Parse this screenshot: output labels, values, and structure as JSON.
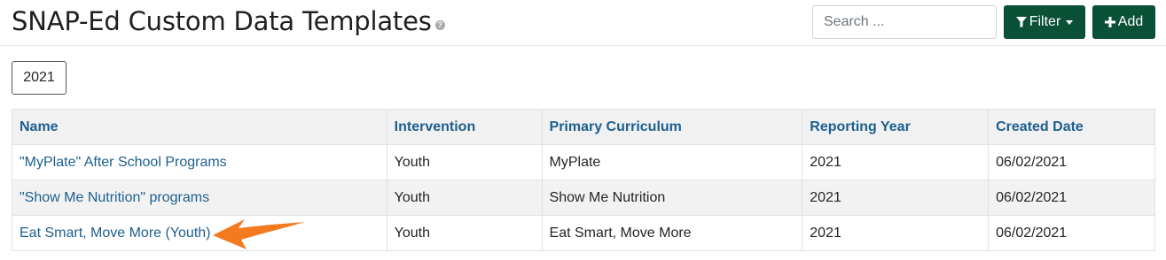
{
  "header": {
    "title": "SNAP-Ed Custom Data Templates",
    "help_icon_glyph": "?",
    "search_placeholder": "Search ...",
    "filter_label": "Filter",
    "add_label": "Add",
    "accent_color": "#0b5138"
  },
  "year_filter": {
    "label": "2021"
  },
  "table": {
    "columns": [
      "Name",
      "Intervention",
      "Primary Curriculum",
      "Reporting Year",
      "Created Date"
    ],
    "rows": [
      {
        "name": "\"MyPlate\" After School Programs",
        "intervention": "Youth",
        "curriculum": "MyPlate",
        "year": "2021",
        "created": "06/02/2021"
      },
      {
        "name": "\"Show Me Nutrition\" programs",
        "intervention": "Youth",
        "curriculum": "Show Me Nutrition",
        "year": "2021",
        "created": "06/02/2021"
      },
      {
        "name": "Eat Smart, Move More (Youth)",
        "intervention": "Youth",
        "curriculum": "Eat Smart, Move More",
        "year": "2021",
        "created": "06/02/2021"
      }
    ]
  },
  "annotation": {
    "arrow_color": "#f47a20",
    "icon": "arrow-left-icon"
  }
}
